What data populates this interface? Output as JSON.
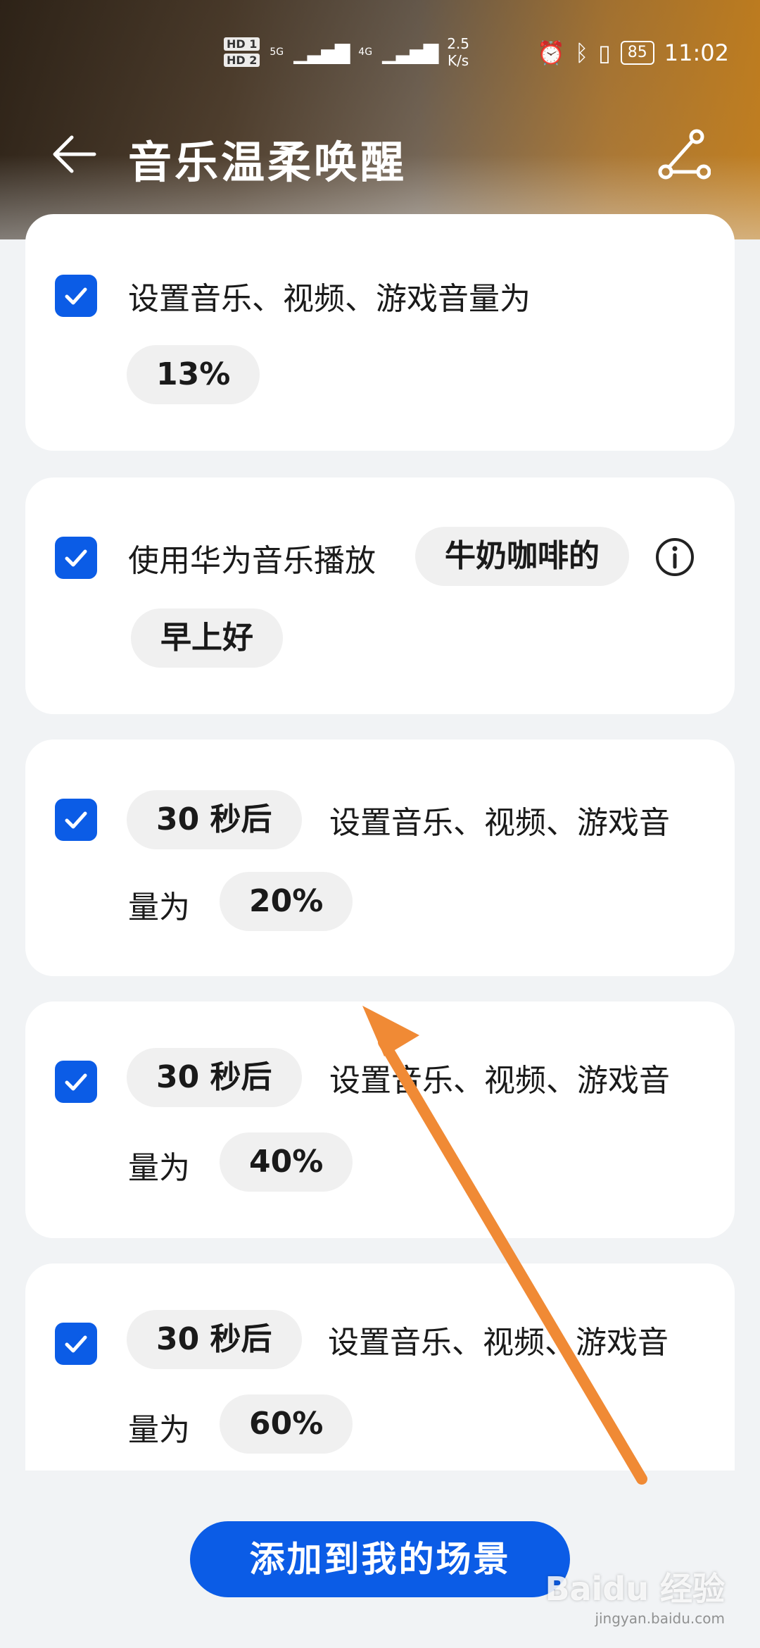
{
  "status_bar": {
    "hd1": "HD 1",
    "hd2": "HD 2",
    "net1": "5G",
    "net2": "4G",
    "speed_value": "2.5",
    "speed_unit": "K/s",
    "battery": "85",
    "time": "11:02"
  },
  "header": {
    "title": "音乐温柔唤醒"
  },
  "cards": [
    {
      "text1": "设置音乐、视频、游戏音量为",
      "pill1": "13%"
    },
    {
      "text1": "使用华为音乐播放",
      "pill1": "牛奶咖啡的",
      "pill2": "早上好"
    },
    {
      "pill1": "30 秒后",
      "text1": "设置音乐、视频、游戏音",
      "text2": "量为",
      "pill2": "20%"
    },
    {
      "pill1": "30 秒后",
      "text1": "设置音乐、视频、游戏音",
      "text2": "量为",
      "pill2": "40%"
    },
    {
      "pill1": "30 秒后",
      "text1": "设置音乐、视频、游戏音",
      "text2": "量为",
      "pill2": "60%"
    }
  ],
  "footer": {
    "add_button": "添加到我的场景"
  },
  "watermark": {
    "text": "Baidu 经验",
    "url": "jingyan.baidu.com"
  },
  "colors": {
    "accent": "#0b5ce6",
    "arrow": "#f08a35"
  }
}
